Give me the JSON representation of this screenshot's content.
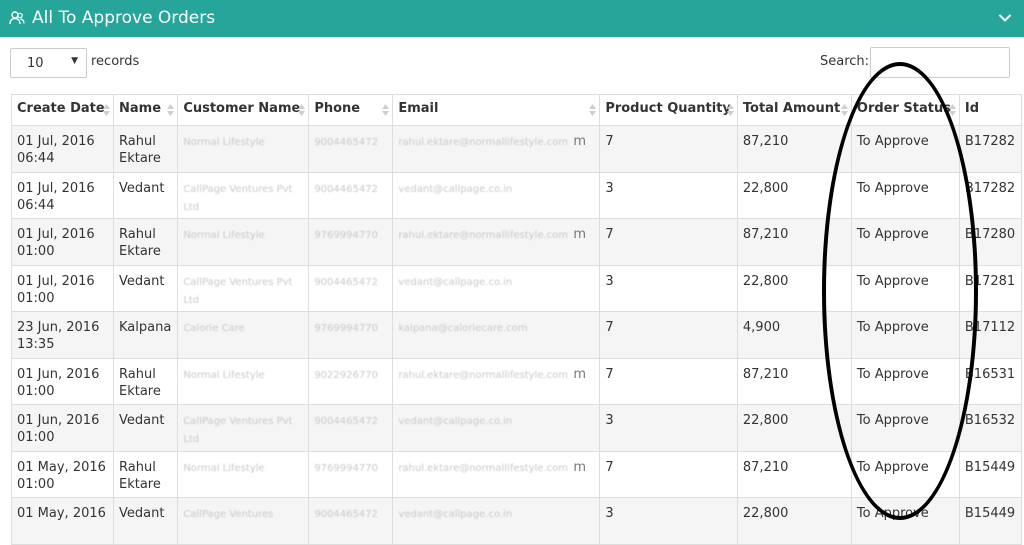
{
  "panel": {
    "title": "All To Approve Orders",
    "icon": "users-icon",
    "accent_color": "#26a69a"
  },
  "controls": {
    "page_length": "10",
    "records_label": "records",
    "search_label": "Search:",
    "search_value": ""
  },
  "table": {
    "columns": [
      "Create Date",
      "Name",
      "Customer Name",
      "Phone",
      "Email",
      "Product Quantity",
      "Total Amount",
      "Order Status",
      "Id"
    ],
    "rows": [
      {
        "date": "01 Jul, 2016",
        "time": "06:44",
        "name": "Rahul Ektare",
        "customer": "Normal Lifestyle",
        "phone": "9004465472",
        "email": "rahul.ektare@normallifestyle.com",
        "email_suffix": "m",
        "qty": "7",
        "amount": "87,210",
        "status": "To Approve",
        "id": "B17282"
      },
      {
        "date": "01 Jul, 2016",
        "time": "06:44",
        "name": "Vedant",
        "customer": "CallPage Ventures Pvt Ltd",
        "phone": "9004465472",
        "email": "vedant@callpage.co.in",
        "email_suffix": "",
        "qty": "3",
        "amount": "22,800",
        "status": "To Approve",
        "id": "B17282"
      },
      {
        "date": "01 Jul, 2016",
        "time": "01:00",
        "name": "Rahul Ektare",
        "customer": "Normal Lifestyle",
        "phone": "9769994770",
        "email": "rahul.ektare@normallifestyle.com",
        "email_suffix": "m",
        "qty": "7",
        "amount": "87,210",
        "status": "To Approve",
        "id": "B17280"
      },
      {
        "date": "01 Jul, 2016",
        "time": "01:00",
        "name": "Vedant",
        "customer": "CallPage Ventures Pvt Ltd",
        "phone": "9004465472",
        "email": "vedant@callpage.co.in",
        "email_suffix": "",
        "qty": "3",
        "amount": "22,800",
        "status": "To Approve",
        "id": "B17281"
      },
      {
        "date": "23 Jun, 2016",
        "time": "13:35",
        "name": "Kalpana",
        "customer": "Calorie Care",
        "phone": "9769994770",
        "email": "kalpana@caloriecare.com",
        "email_suffix": "",
        "qty": "7",
        "amount": "4,900",
        "status": "To Approve",
        "id": "B17112"
      },
      {
        "date": "01 Jun, 2016",
        "time": "01:00",
        "name": "Rahul Ektare",
        "customer": "Normal Lifestyle",
        "phone": "9022926770",
        "email": "rahul.ektare@normallifestyle.com",
        "email_suffix": "m",
        "qty": "7",
        "amount": "87,210",
        "status": "To Approve",
        "id": "B16531"
      },
      {
        "date": "01 Jun, 2016",
        "time": "01:00",
        "name": "Vedant",
        "customer": "CallPage Ventures Pvt Ltd",
        "phone": "9004465472",
        "email": "vedant@callpage.co.in",
        "email_suffix": "",
        "qty": "3",
        "amount": "22,800",
        "status": "To Approve",
        "id": "B16532"
      },
      {
        "date": "01 May, 2016",
        "time": "01:00",
        "name": "Rahul Ektare",
        "customer": "Normal Lifestyle",
        "phone": "9769994770",
        "email": "rahul.ektare@normallifestyle.com",
        "email_suffix": "m",
        "qty": "7",
        "amount": "87,210",
        "status": "To Approve",
        "id": "B15449"
      },
      {
        "date": "01 May, 2016",
        "time": "",
        "name": "Vedant",
        "customer": "CallPage Ventures",
        "phone": "9004465472",
        "email": "vedant@callpage.co.in",
        "email_suffix": "",
        "qty": "3",
        "amount": "22,800",
        "status": "To Approve",
        "id": "B15449"
      }
    ]
  }
}
